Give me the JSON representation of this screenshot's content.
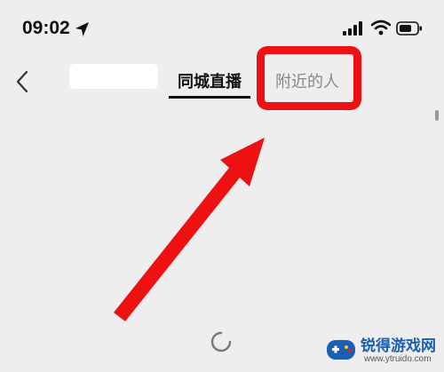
{
  "status_bar": {
    "time": "09:02",
    "location_icon": "location-arrow-icon",
    "signal_icon": "cellular-signal-icon",
    "wifi_icon": "wifi-icon",
    "battery_icon": "battery-icon"
  },
  "nav": {
    "back_icon": "chevron-left-icon",
    "tabs": [
      {
        "label": "同城直播"
      },
      {
        "label": "附近的人"
      }
    ]
  },
  "annotation": {
    "highlight_color": "#ee1111",
    "arrow_color": "#ee1111"
  },
  "watermark": {
    "title": "锐得游戏网",
    "url": "www.ytruido.com"
  },
  "colors": {
    "background": "#eeeeee",
    "active_tab": "#111111",
    "inactive_tab": "#888888"
  }
}
